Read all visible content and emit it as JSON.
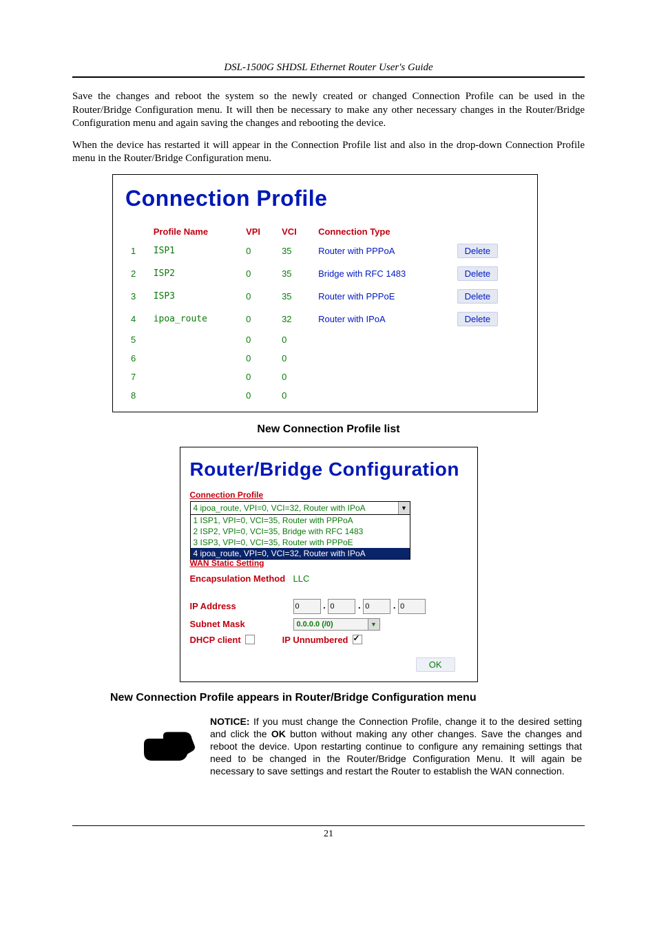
{
  "doc_header": "DSL-1500G SHDSL Ethernet Router User's Guide",
  "page_number": "21",
  "para1": "Save the changes and reboot the system so the newly created or changed Connection Profile can be used in the Router/Bridge Configuration menu. It will then be necessary to make any other necessary changes in the Router/Bridge Configuration menu and again saving the changes and rebooting the device.",
  "para2": "When the device has restarted it will appear in the Connection Profile list and also in the drop-down Connection Profile menu in the Router/Bridge Configuration menu.",
  "fig1": {
    "title": "Connection Profile",
    "headers": {
      "name": "Profile Name",
      "vpi": "VPI",
      "vci": "VCI",
      "ctype": "Connection Type"
    },
    "rows": [
      {
        "idx": "1",
        "name": "ISP1",
        "vpi": "0",
        "vci": "35",
        "ctype": "Router with PPPoA",
        "del": "Delete"
      },
      {
        "idx": "2",
        "name": "ISP2",
        "vpi": "0",
        "vci": "35",
        "ctype": "Bridge with RFC 1483",
        "del": "Delete"
      },
      {
        "idx": "3",
        "name": "ISP3",
        "vpi": "0",
        "vci": "35",
        "ctype": "Router with PPPoE",
        "del": "Delete"
      },
      {
        "idx": "4",
        "name": "ipoa_route",
        "vpi": "0",
        "vci": "32",
        "ctype": "Router with IPoA",
        "del": "Delete"
      },
      {
        "idx": "5",
        "name": "",
        "vpi": "0",
        "vci": "0",
        "ctype": "",
        "del": ""
      },
      {
        "idx": "6",
        "name": "",
        "vpi": "0",
        "vci": "0",
        "ctype": "",
        "del": ""
      },
      {
        "idx": "7",
        "name": "",
        "vpi": "0",
        "vci": "0",
        "ctype": "",
        "del": ""
      },
      {
        "idx": "8",
        "name": "",
        "vpi": "0",
        "vci": "0",
        "ctype": "",
        "del": ""
      }
    ]
  },
  "caption1": "New Connection Profile list",
  "fig2": {
    "title": "Router/Bridge Configuration",
    "conn_profile_label": "Connection Profile",
    "dd_selected": "4 ipoa_route, VPI=0, VCI=32, Router with IPoA",
    "dd_options": [
      "1 ISP1, VPI=0, VCI=35, Router with PPPoA",
      "2 ISP2, VPI=0, VCI=35, Bridge with RFC 1483",
      "3 ISP3, VPI=0, VCI=35, Router with PPPoE",
      "4 ipoa_route, VPI=0, VCI=32, Router with IPoA"
    ],
    "wan_static": "WAN Static Setting",
    "encap_label": "Encapsulation Method",
    "encap_value": "LLC",
    "ip_label": "IP Address",
    "ip": [
      "0",
      "0",
      "0",
      "0"
    ],
    "subnet_label": "Subnet Mask",
    "subnet_value": "0.0.0.0 (/0)",
    "dhcp_label": "DHCP client",
    "ipun_label": "IP Unnumbered",
    "ok": "OK"
  },
  "caption2": "New Connection Profile appears in Router/Bridge Configuration menu",
  "notice_label": "NOTICE:",
  "notice_text_1": " If you must change the Connection Profile, change it to the desired setting and click the ",
  "notice_bold": "OK",
  "notice_text_2": " button without making any other changes. Save the changes and reboot the device. Upon restarting continue to configure any remaining settings that need to be changed in the Router/Bridge Configuration Menu. It will again be necessary to save settings and restart the Router to establish the WAN connection."
}
